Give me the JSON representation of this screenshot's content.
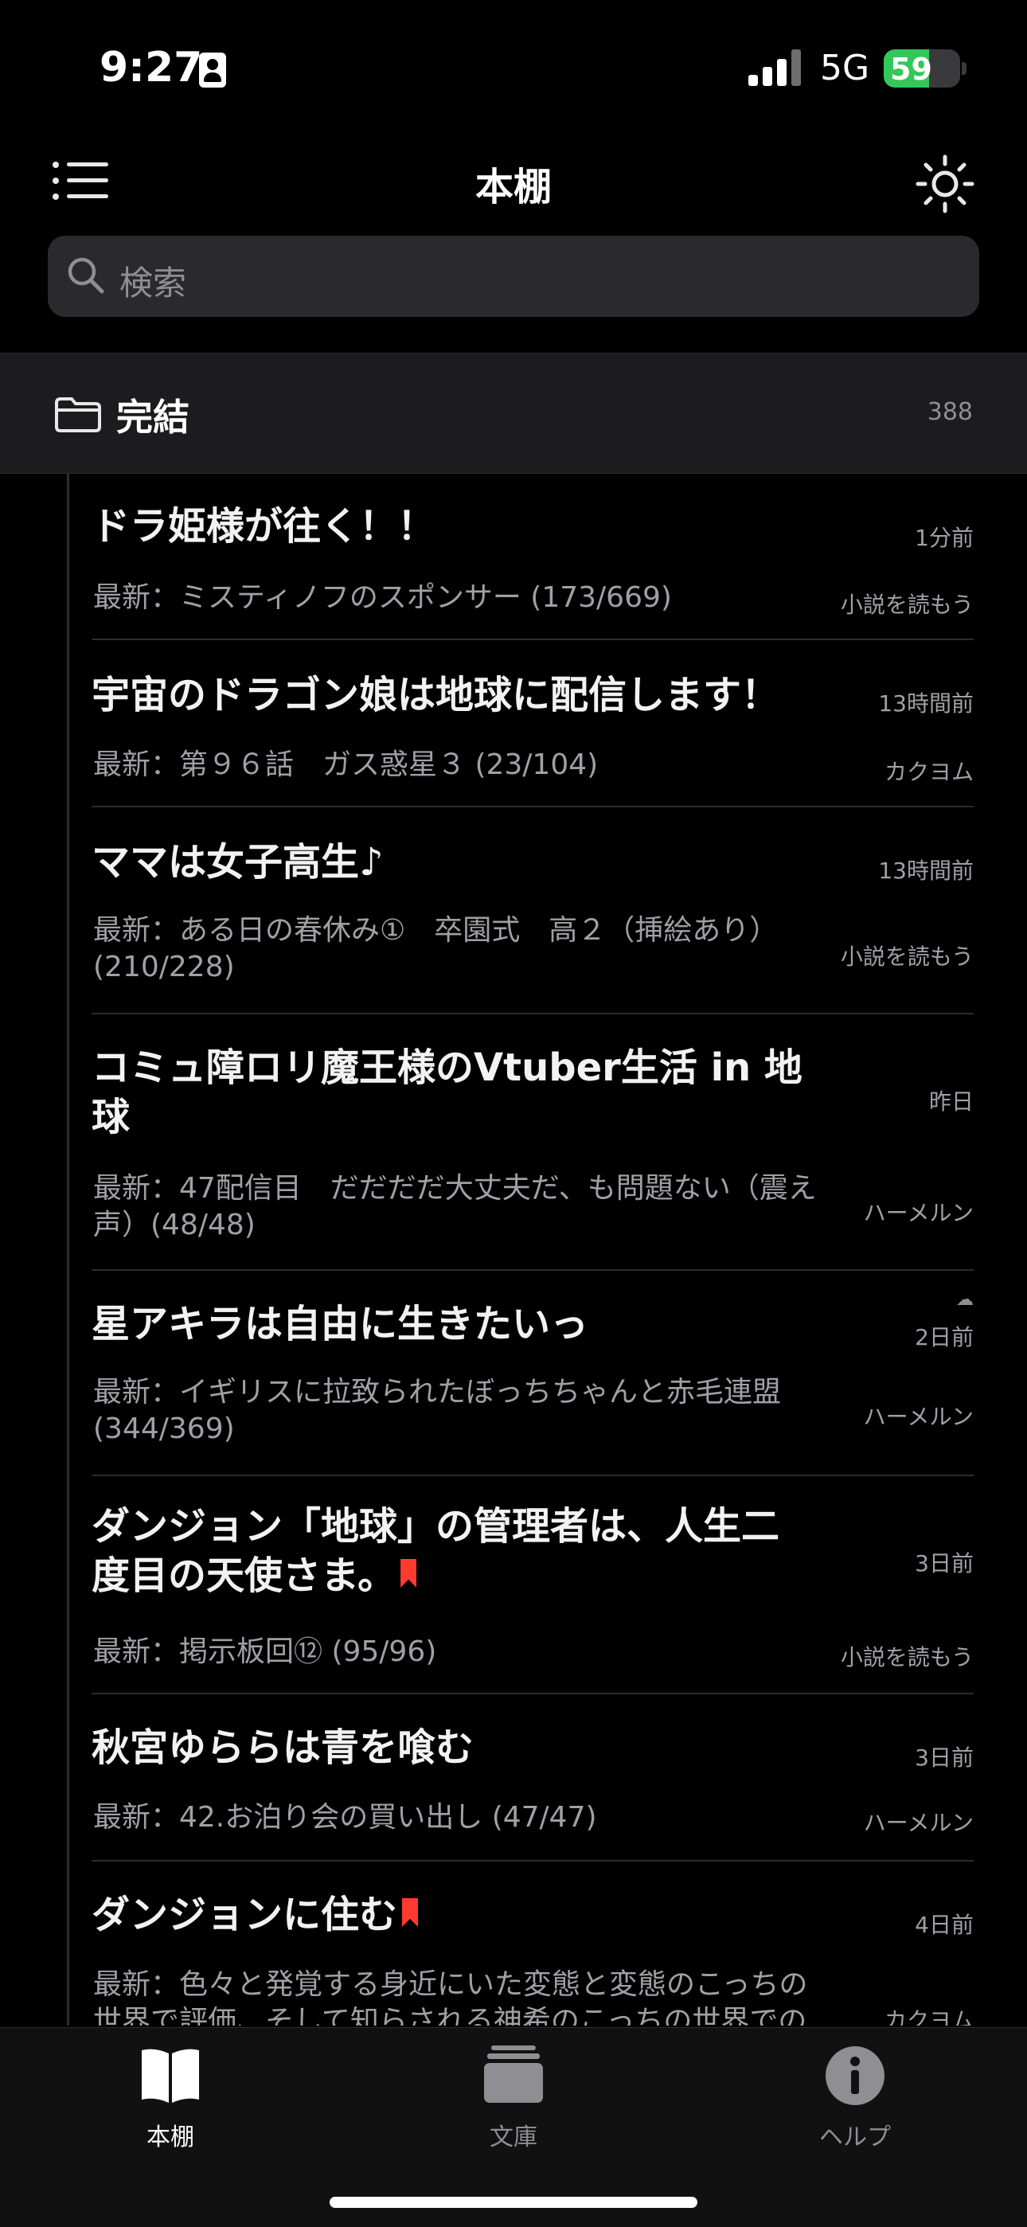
{
  "status_bar": {
    "time": "9:27",
    "network": "5G",
    "battery": "59",
    "battery_level": 0.59
  },
  "nav": {
    "title": "本棚"
  },
  "search": {
    "placeholder": "検索"
  },
  "section": {
    "title": "完結",
    "count": "388"
  },
  "items": [
    {
      "title": "ドラ姫様が往く！！",
      "subtitle": "最新：ミスティノフのスポンサー (173/669)",
      "time": "1分前",
      "source": "小説を読もう",
      "bookmark": false
    },
    {
      "title": "宇宙のドラゴン娘は地球に配信します！",
      "subtitle": "最新：第９６話　ガス惑星３ (23/104)",
      "time": "13時間前",
      "source": "カクヨム",
      "bookmark": false
    },
    {
      "title": "ママは女子高生♪",
      "subtitle": "最新：ある日の春休み①　卒園式　高２（挿絵あり）(210/228)",
      "time": "13時間前",
      "source": "小説を読もう",
      "bookmark": false
    },
    {
      "title": "コミュ障ロリ魔王様のVtuber生活 in 地球",
      "subtitle": "最新：47配信目　だだだだ大丈夫だ、も問題ない（震え声）(48/48)",
      "time": "昨日",
      "source": "ハーメルン",
      "bookmark": false
    },
    {
      "title": "星アキラは自由に生きたいっ",
      "subtitle": "最新：イギリスに拉致られたぼっちちゃんと赤毛連盟 (344/369)",
      "time": "2日前",
      "source": "ハーメルン",
      "bookmark": false,
      "cloud": true
    },
    {
      "title": "ダンジョン「地球」の管理者は、人生二度目の天使さま。",
      "subtitle": "最新：掲示板回⑫ (95/96)",
      "time": "3日前",
      "source": "小説を読もう",
      "bookmark": true
    },
    {
      "title": "秋宮ゆららは青を喰む",
      "subtitle": "最新：42.お泊り会の買い出し (47/47)",
      "time": "3日前",
      "source": "ハーメルン",
      "bookmark": false
    },
    {
      "title": "ダンジョンに住む",
      "subtitle": "最新：色々と発覚する身近にいた変態と変態のこっちの世界で評価、そして知らされる神希のこっちの世界での",
      "time": "4日前",
      "source": "カクヨム",
      "bookmark": true
    }
  ],
  "tabs": [
    {
      "label": "本棚",
      "active": true,
      "icon": "book-icon"
    },
    {
      "label": "文庫",
      "active": false,
      "icon": "library-icon"
    },
    {
      "label": "ヘルプ",
      "active": false,
      "icon": "info-icon"
    }
  ],
  "colors": {
    "bookmark": "#ff3b30",
    "battery": "#34c759",
    "active_tab": "#ffffff",
    "inactive_tab": "#8e8e93"
  }
}
